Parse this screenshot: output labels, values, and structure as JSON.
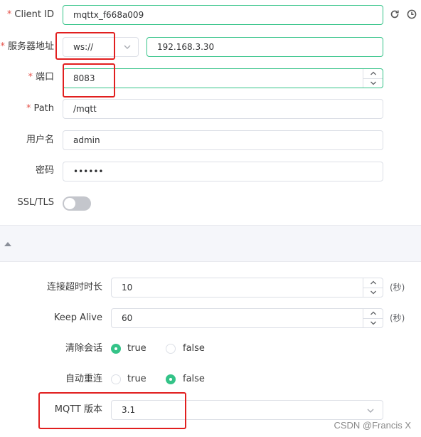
{
  "fields": {
    "client_id": {
      "label": "Client ID",
      "value": "mqttx_f668a009"
    },
    "host": {
      "label": "服务器地址",
      "protocol": "ws://",
      "value": "192.168.3.30"
    },
    "port": {
      "label": "端口",
      "value": "8083"
    },
    "path": {
      "label": "Path",
      "value": "/mqtt"
    },
    "username": {
      "label": "用户名",
      "value": "admin"
    },
    "password": {
      "label": "密码",
      "value": "••••••"
    },
    "ssl": {
      "label": "SSL/TLS",
      "enabled": false
    }
  },
  "required_mark": "*",
  "advanced": {
    "connect_timeout": {
      "label": "连接超时时长",
      "value": "10",
      "unit": "(秒)"
    },
    "keep_alive": {
      "label": "Keep Alive",
      "value": "60",
      "unit": "(秒)"
    },
    "clean_session": {
      "label": "清除会话",
      "options": [
        "true",
        "false"
      ],
      "selected": "true"
    },
    "auto_reconnect": {
      "label": "自动重连",
      "options": [
        "true",
        "false"
      ],
      "selected": "false"
    },
    "mqtt_version": {
      "label": "MQTT 版本",
      "value": "3.1"
    }
  },
  "watermark": "CSDN @Francis X",
  "colors": {
    "accent": "#34c388",
    "highlight": "#e11f1f"
  }
}
